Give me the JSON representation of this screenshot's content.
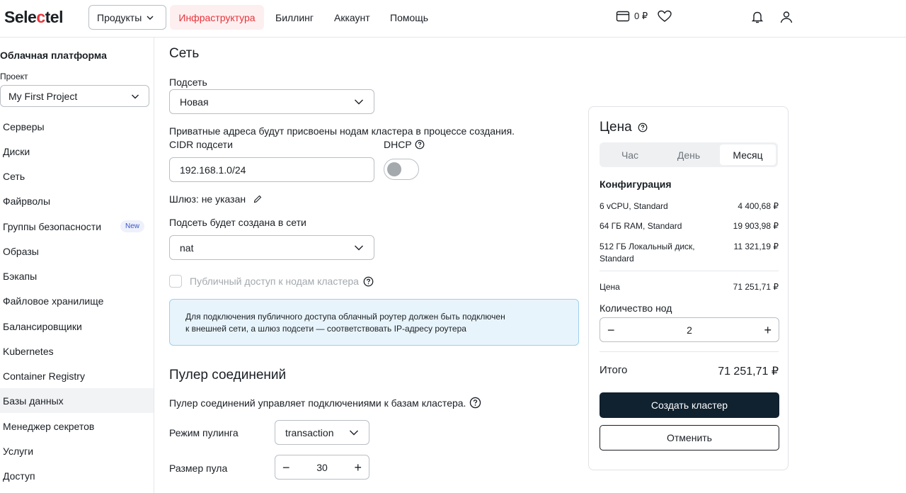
{
  "header": {
    "logo_pre": "Sele",
    "logo_accent": "c",
    "logo_post": "tel",
    "products_label": "Продукты",
    "nav": [
      "Инфраструктура",
      "Биллинг",
      "Аккаунт",
      "Помощь"
    ],
    "balance": "0 ₽"
  },
  "sidebar": {
    "title": "Облачная платформа",
    "project_label": "Проект",
    "project_value": "My First Project",
    "items": [
      "Серверы",
      "Диски",
      "Сеть",
      "Файрволы",
      "Группы безопасности",
      "Образы",
      "Бэкапы",
      "Файловое хранилище",
      "Балансировщики",
      "Kubernetes",
      "Container Registry",
      "Базы данных",
      "Менеджер секретов",
      "Услуги",
      "Доступ"
    ],
    "new_badge": "New",
    "active_item": "Базы данных"
  },
  "network": {
    "title": "Сеть",
    "subnet_label": "Подсеть",
    "subnet_value": "Новая",
    "private_note": "Приватные адреса будут присвоены нодам кластера в процессе создания.",
    "cidr_label": "CIDR подсети",
    "cidr_value": "192.168.1.0/24",
    "dhcp_label": "DHCP",
    "gateway_text": "Шлюз: не указан",
    "network_label": "Подсеть будет создана в сети",
    "network_value": "nat",
    "public_access_label": "Публичный доступ к нодам кластера",
    "info_line1": "Для подключения публичного доступа облачный роутер должен быть подключен",
    "info_line2": "к внешней сети, а шлюз подсети — соответствовать IP-адресу роутера"
  },
  "pooler": {
    "title": "Пулер соединений",
    "description": "Пулер соединений управляет подключениями к базам кластера.",
    "mode_label": "Режим пулинга",
    "mode_value": "transaction",
    "size_label": "Размер пула",
    "size_value": "30"
  },
  "price": {
    "title": "Цена",
    "periods": [
      "Час",
      "День",
      "Месяц"
    ],
    "selected_period": "Месяц",
    "config_title": "Конфигурация",
    "lines": [
      {
        "name": "6 vCPU, Standard",
        "value": "4 400,68 ₽"
      },
      {
        "name": "64 ГБ RAM, Standard",
        "value": "19 903,98 ₽"
      },
      {
        "name_line1": "512 ГБ Локальный диск,",
        "name_line2": "Standard",
        "value": "11 321,19 ₽"
      }
    ],
    "price_label": "Цена",
    "price_value": "71 251,71 ₽",
    "nodes_label": "Количество нод",
    "nodes_value": "2",
    "total_label": "Итого",
    "total_value": "71 251,71 ₽",
    "create_label": "Создать кластер",
    "cancel_label": "Отменить"
  }
}
